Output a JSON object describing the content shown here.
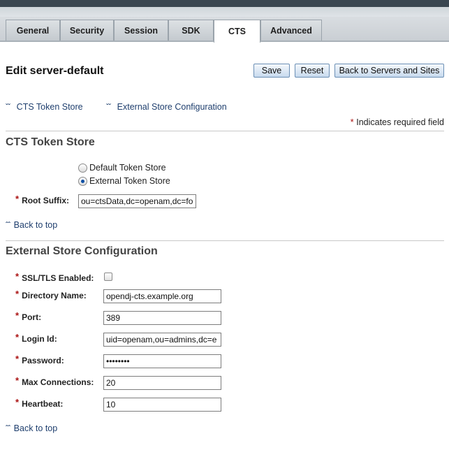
{
  "tabs": [
    {
      "label": "General"
    },
    {
      "label": "Security"
    },
    {
      "label": "Session"
    },
    {
      "label": "SDK"
    },
    {
      "label": "CTS",
      "active": true
    },
    {
      "label": "Advanced"
    }
  ],
  "page": {
    "title": "Edit server-default",
    "buttons": {
      "save": "Save",
      "reset": "Reset",
      "back": "Back to Servers and Sites"
    }
  },
  "jump_links": {
    "cts_token_store": "CTS Token Store",
    "external_store_config": "External Store Configuration"
  },
  "required_note": {
    "mark": "*",
    "text": "Indicates required field"
  },
  "cts_section": {
    "heading": "CTS Token Store",
    "options": {
      "default": "Default Token Store",
      "external": "External Token Store"
    },
    "selected": "external",
    "root_suffix": {
      "label": "Root Suffix:",
      "value": "ou=ctsData,dc=openam,dc=fo"
    },
    "back_to_top": "Back to top"
  },
  "external_section": {
    "heading": "External Store Configuration",
    "ssl": {
      "label": "SSL/TLS Enabled:",
      "checked": false
    },
    "directory_name": {
      "label": "Directory Name:",
      "value": "opendj-cts.example.org"
    },
    "port": {
      "label": "Port:",
      "value": "389"
    },
    "login_id": {
      "label": "Login Id:",
      "value": "uid=openam,ou=admins,dc=e"
    },
    "password": {
      "label": "Password:",
      "value": "••••••••"
    },
    "max_connections": {
      "label": "Max Connections:",
      "value": "20"
    },
    "heartbeat": {
      "label": "Heartbeat:",
      "value": "10"
    },
    "back_to_top": "Back to top"
  },
  "icons": {
    "chevron": "double-chevron-down-icon",
    "up": "double-chevron-up-icon"
  },
  "colors": {
    "link": "#1f3f6e",
    "required": "#aa1111",
    "button_border": "#6b8fb5"
  }
}
